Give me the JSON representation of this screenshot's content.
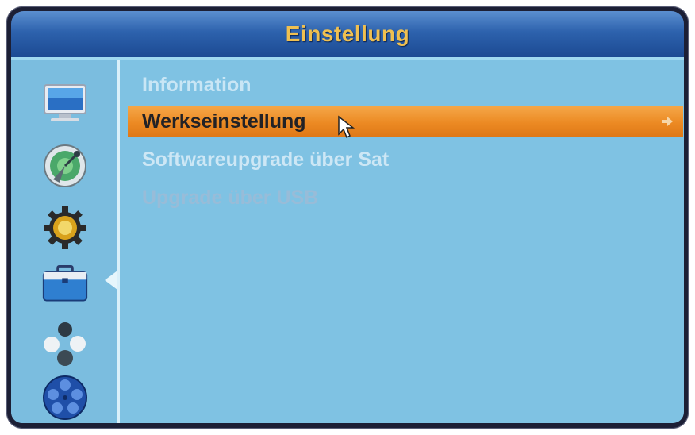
{
  "header": {
    "title": "Einstellung"
  },
  "menu": {
    "items": [
      {
        "label": "Information",
        "state": "normal"
      },
      {
        "label": "Werkseinstellung",
        "state": "selected"
      },
      {
        "label": "Softwareupgrade über Sat",
        "state": "normal"
      },
      {
        "label": "Upgrade über USB",
        "state": "disabled"
      }
    ]
  },
  "sidebar": {
    "icons": [
      "tv-icon",
      "satellite-dish-icon",
      "gear-icon",
      "toolbox-icon",
      "games-icon",
      "media-reel-icon"
    ],
    "active_index": 3
  },
  "colors": {
    "highlight": "#ec8a23",
    "header": "#2d62ad",
    "title": "#f0c050",
    "background": "#7fc2e3"
  }
}
